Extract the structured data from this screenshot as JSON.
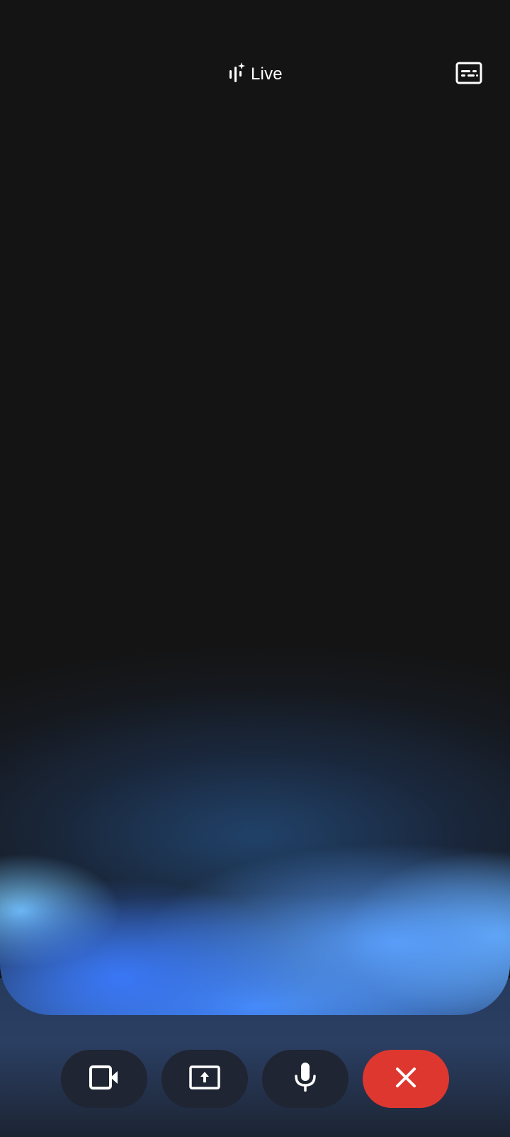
{
  "header": {
    "title": "Live",
    "title_icon": "sparkle-waveform-icon",
    "captions_icon": "closed-captions-icon"
  },
  "controls": [
    {
      "name": "camera",
      "icon": "video-camera-icon"
    },
    {
      "name": "share-screen",
      "icon": "screen-share-icon"
    },
    {
      "name": "microphone",
      "icon": "microphone-icon"
    },
    {
      "name": "end-session",
      "icon": "close-icon"
    }
  ],
  "colors": {
    "background": "#141414",
    "control_bg": "#1f2533",
    "end_button": "#de3730",
    "glow_blue": "#3a78fa",
    "glow_light": "#78c8ff"
  }
}
